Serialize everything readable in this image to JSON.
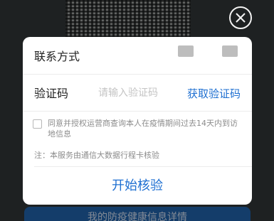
{
  "modal": {
    "contact_label": "联系方式",
    "code_label": "验证码",
    "code_placeholder": "请输入验证码",
    "get_code_label": "获取验证码",
    "agree_text": "同意并授权运营商查询本人在疫情期间过去14天内到访地信息",
    "note_text": "注：本服务由通信大数据行程卡核验",
    "start_label": "开始核验"
  },
  "background": {
    "bottom_bar_text": "我的防疫健康信息详情"
  },
  "colors": {
    "accent": "#1e6fd1",
    "overlay": "#2f3435",
    "bottom_bar": "#1f5fa3"
  },
  "icons": {
    "close": "close-circle-icon"
  }
}
